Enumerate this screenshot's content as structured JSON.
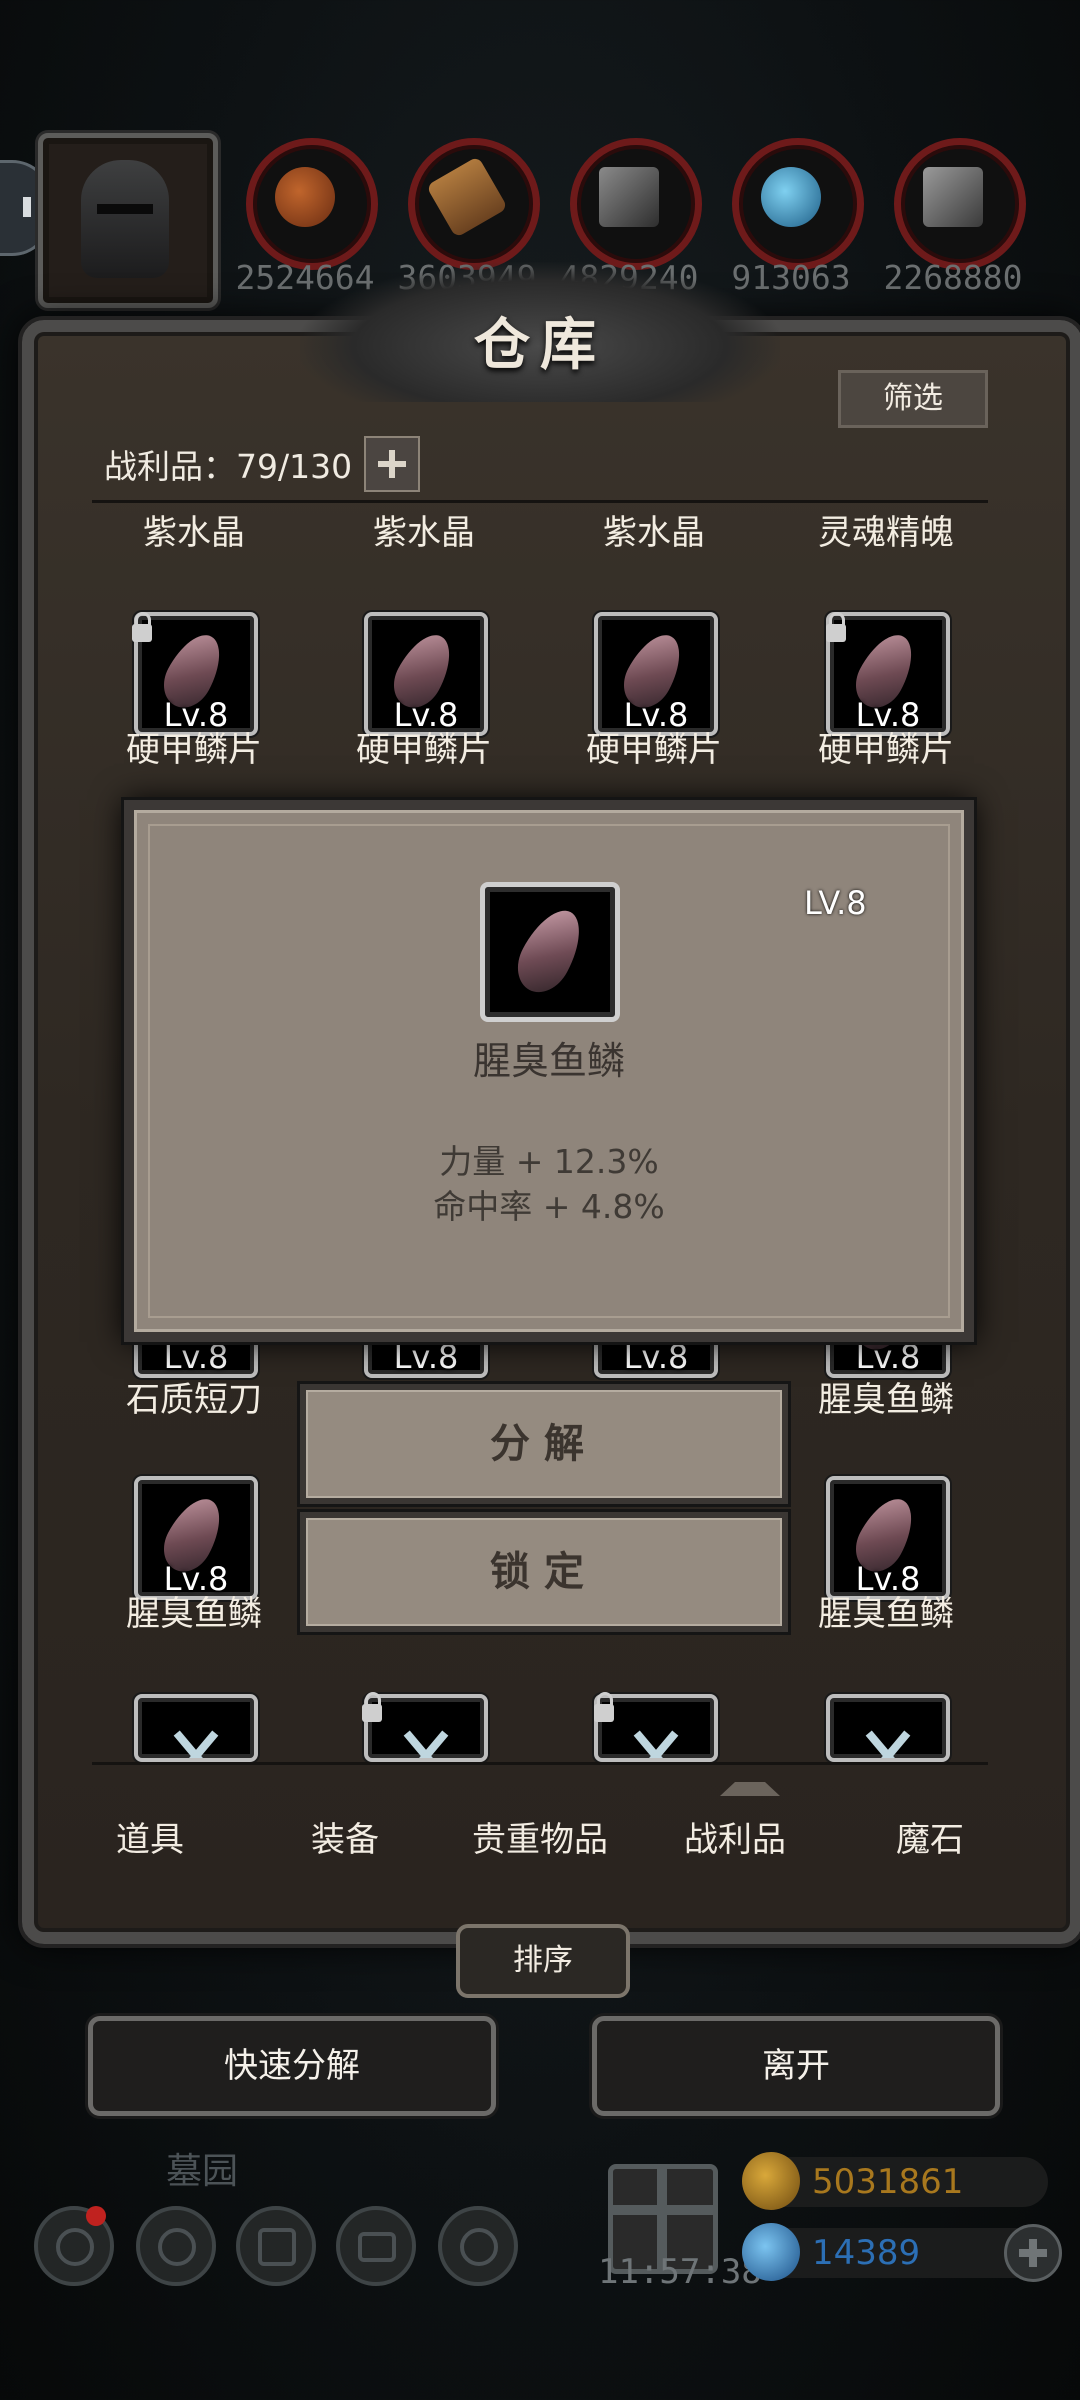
{
  "resources": {
    "counts": [
      "2524664",
      "3603949",
      "4829240",
      "913063",
      "2268880"
    ],
    "icons": [
      "meat-icon",
      "wood-icon",
      "iron-ingot-icon",
      "crystal-icon",
      "stone-icon"
    ]
  },
  "panel": {
    "title": "仓库",
    "filter_label": "筛选",
    "count_label": "战利品：79/130"
  },
  "grid": {
    "top_labels": [
      "紫水晶",
      "紫水晶",
      "紫水晶",
      "灵魂精魄"
    ],
    "row1": [
      {
        "lv": "Lv.8",
        "name": "硬甲鳞片"
      },
      {
        "lv": "Lv.8",
        "name": "硬甲鳞片"
      },
      {
        "lv": "Lv.8",
        "name": "硬甲鳞片"
      },
      {
        "lv": "Lv.8",
        "name": "硬甲鳞片"
      }
    ],
    "row3": [
      {
        "lv": "Lv.8",
        "name": "石质短刀"
      },
      {
        "lv": "Lv.8",
        "name": ""
      },
      {
        "lv": "Lv.8",
        "name": ""
      },
      {
        "lv": "Lv.8",
        "name": "腥臭鱼鳞"
      }
    ],
    "row4": [
      {
        "lv": "Lv.8",
        "name": "腥臭鱼鳞"
      },
      {
        "lv": "Lv.8",
        "name": "腥臭鱼鳞"
      }
    ]
  },
  "popup": {
    "level": "LV.8",
    "item_name": "腥臭鱼鳞",
    "stats": [
      "力量 + 12.3%",
      "命中率 + 4.8%"
    ]
  },
  "actions": {
    "decompose": "分解",
    "lock": "锁定"
  },
  "tabs": [
    "道具",
    "装备",
    "贵重物品",
    "战利品",
    "魔石"
  ],
  "active_tab": "战利品",
  "sort_label": "排序",
  "bottom_buttons": {
    "quick_decompose": "快速分解",
    "leave": "离开"
  },
  "hud": {
    "zone": "墓园",
    "timer": "11:57:38",
    "gold": "5031861",
    "gems": "14389"
  },
  "colors": {
    "gold_text": "#a8781e",
    "gem_text": "#2c6fb5"
  }
}
